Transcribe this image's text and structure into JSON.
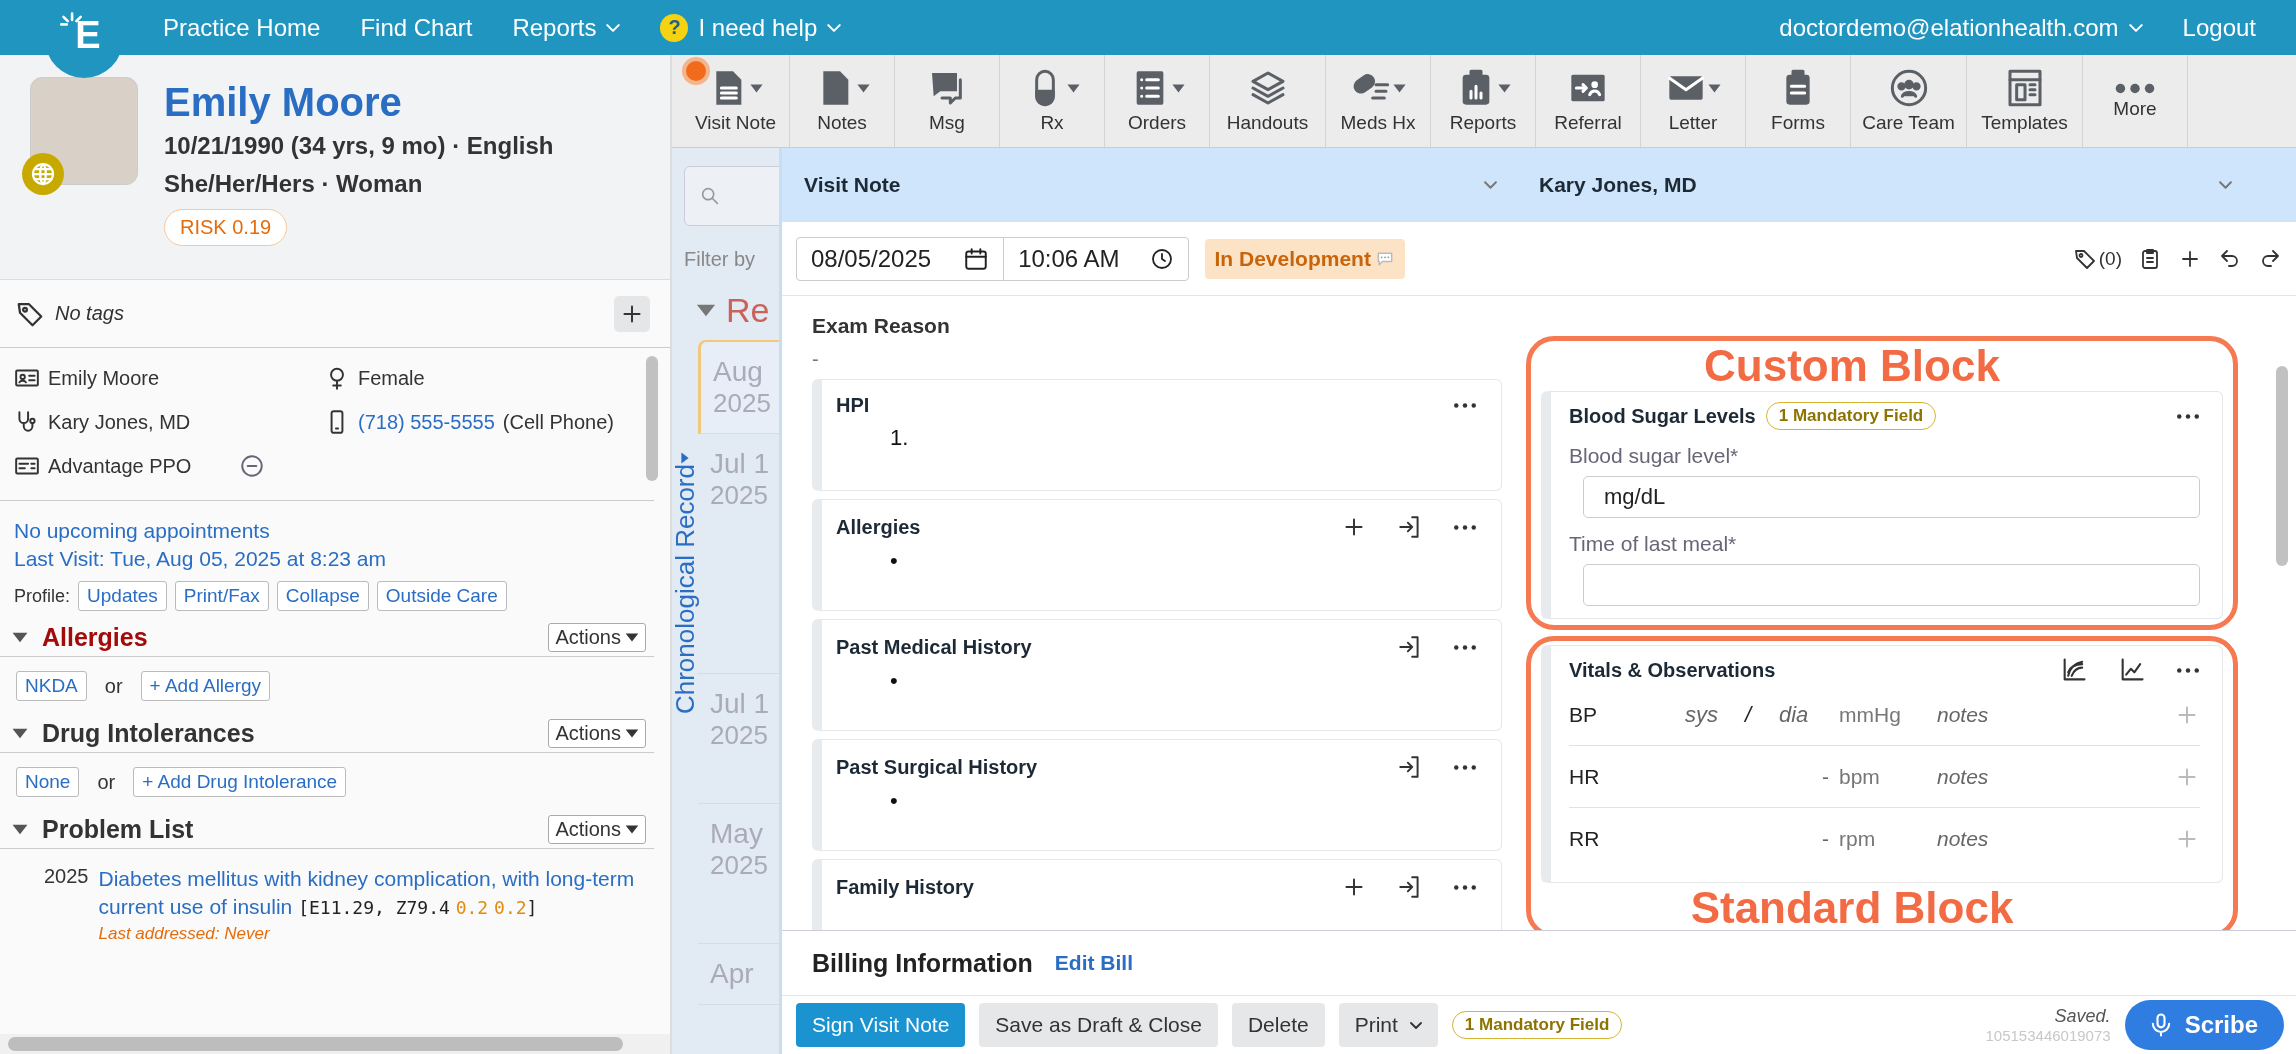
{
  "top_nav": {
    "logo_text": "E",
    "links": [
      {
        "label": "Practice Home",
        "dropdown": false
      },
      {
        "label": "Find Chart",
        "dropdown": false
      },
      {
        "label": "Reports",
        "dropdown": true
      }
    ],
    "help": {
      "icon_text": "?",
      "label": "I need help",
      "dropdown": true
    },
    "user": {
      "label": "doctordemo@elationhealth.com",
      "dropdown": true
    },
    "logout": "Logout"
  },
  "patient": {
    "name": "Emily Moore",
    "dob_line": "10/21/1990 (34 yrs, 9 mo) · English",
    "identity_line": "She/Her/Hers · Woman",
    "risk": "RISK 0.19",
    "tags": "No tags",
    "details": [
      {
        "kind": "name",
        "text": "Emily Moore"
      },
      {
        "kind": "sex",
        "text": "Female"
      },
      {
        "kind": "provider",
        "text": "Kary Jones, MD"
      },
      {
        "kind": "phone",
        "link": "(718) 555-5555",
        "text": "(Cell Phone)"
      },
      {
        "kind": "insurance",
        "text": "Advantage PPO"
      }
    ],
    "appointments": "No upcoming appointments",
    "last_visit": "Last Visit: Tue, Aug 05, 2025 at 8:23 am",
    "profile_label": "Profile:",
    "profile_buttons": [
      "Updates",
      "Print/Fax",
      "Collapse",
      "Outside Care"
    ],
    "sections": [
      {
        "title": "Allergies",
        "alert": true,
        "expanded": true,
        "actions": "Actions",
        "options": [
          "NKDA",
          "+ Add Allergy"
        ],
        "separator": "or"
      },
      {
        "title": "Drug Intolerances",
        "alert": false,
        "expanded": true,
        "actions": "Actions",
        "options": [
          "None",
          "+ Add Drug Intolerance"
        ],
        "separator": "or"
      },
      {
        "title": "Problem List",
        "alert": false,
        "expanded": true,
        "actions": "Actions",
        "problems": [
          {
            "year": "2025",
            "title": "Diabetes mellitus with kidney complication, with long-term current use of insulin",
            "codes": "[E11.29, Z79.4",
            "scores": [
              "0.2",
              "0.2"
            ],
            "close": "]",
            "last_addressed": "Last addressed: Never"
          }
        ]
      }
    ]
  },
  "toolbar": [
    {
      "label": "Visit Note",
      "dropdown": true,
      "notification": true
    },
    {
      "label": "Notes",
      "dropdown": true,
      "notification": false
    },
    {
      "label": "Msg",
      "dropdown": false,
      "notification": false
    },
    {
      "label": "Rx",
      "dropdown": true,
      "notification": false
    },
    {
      "label": "Orders",
      "dropdown": true,
      "notification": false
    },
    {
      "label": "Handouts",
      "dropdown": false,
      "notification": false
    },
    {
      "label": "Meds Hx",
      "dropdown": true,
      "notification": false
    },
    {
      "label": "Reports",
      "dropdown": true,
      "notification": false
    },
    {
      "label": "Referral",
      "dropdown": false,
      "notification": false
    },
    {
      "label": "Letter",
      "dropdown": true,
      "notification": false
    },
    {
      "label": "Forms",
      "dropdown": false,
      "notification": false
    },
    {
      "label": "Care Team",
      "dropdown": false,
      "notification": false
    },
    {
      "label": "Templates",
      "dropdown": false,
      "notification": false
    },
    {
      "label": "More",
      "dropdown": false,
      "notification": false
    }
  ],
  "timeline": {
    "filter_label": "Filter by",
    "header": "Re",
    "title": "Chronological Record",
    "entries": [
      {
        "date": "Aug",
        "year": "2025",
        "selected": true
      },
      {
        "date": "Jul 1",
        "year": "2025",
        "selected": false
      },
      {
        "date": "Jul 1",
        "year": "2025",
        "selected": false
      },
      {
        "date": "May",
        "year": "2025",
        "selected": false
      },
      {
        "date": "Apr",
        "selected": false
      }
    ]
  },
  "note": {
    "type": "Visit Note",
    "provider": "Kary Jones, MD",
    "date": "08/05/2025",
    "time": "10:06 AM",
    "status": "In Development",
    "tag_count": "(0)",
    "exam_reason": {
      "label": "Exam Reason",
      "value": "-"
    },
    "left_cards": [
      {
        "title": "HPI",
        "marker": "1.",
        "add": false,
        "import": false
      },
      {
        "title": "Allergies",
        "marker": "•",
        "add": true,
        "import": true
      },
      {
        "title": "Past Medical History",
        "marker": "•",
        "add": false,
        "import": true
      },
      {
        "title": "Past Surgical History",
        "marker": "•",
        "add": false,
        "import": true
      },
      {
        "title": "Family History",
        "add": true,
        "import": true
      }
    ],
    "right_cards": [
      {
        "kind": "custom",
        "annotation": "Custom Block",
        "title": "Blood Sugar Levels",
        "badge": "1 Mandatory Field",
        "fields": [
          {
            "label": "Blood sugar level*",
            "unit": "mg/dL"
          },
          {
            "label": "Time of last meal*"
          }
        ]
      },
      {
        "kind": "vitals",
        "annotation": "Standard Block",
        "title": "Vitals & Observations",
        "rows": [
          {
            "label": "BP",
            "kind": "pair",
            "placeholders": [
              "sys",
              "dia"
            ],
            "separator": "/",
            "unit": "mmHg",
            "placeholder": "notes"
          },
          {
            "label": "HR",
            "kind": "single",
            "value": "-",
            "unit": "bpm",
            "placeholder": "notes"
          },
          {
            "label": "RR",
            "kind": "single",
            "value": "-",
            "unit": "rpm",
            "placeholder": "notes"
          }
        ]
      }
    ]
  },
  "billing": {
    "title": "Billing Information",
    "link": "Edit Bill"
  },
  "footer": {
    "buttons": [
      {
        "label": "Sign Visit Note",
        "kind": "primary"
      },
      {
        "label": "Save as Draft & Close",
        "kind": "secondary"
      },
      {
        "label": "Delete",
        "kind": "secondary"
      },
      {
        "label": "Print",
        "kind": "dropdown"
      }
    ],
    "badge": "1 Mandatory Field",
    "status": "Saved.",
    "note_id": "105153446019073",
    "scribe": "Scribe"
  }
}
